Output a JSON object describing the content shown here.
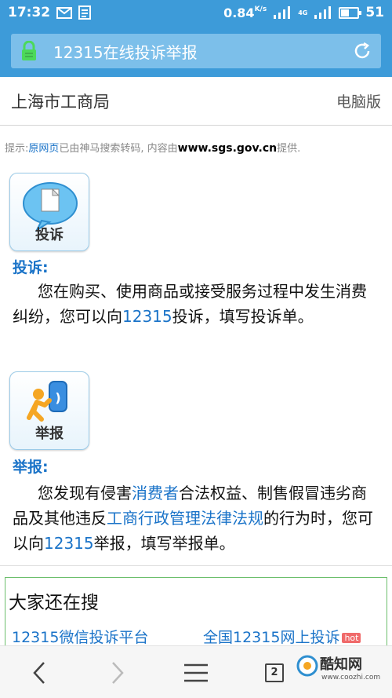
{
  "status_bar": {
    "time": "17:32",
    "speed": "0.84",
    "speed_unit": "K/s",
    "network": "4G",
    "battery": "51",
    "battery_level": 0.51
  },
  "address_bar": {
    "title": "12315在线投诉举报",
    "lock_icon": "lock-icon",
    "refresh_icon": "refresh-icon"
  },
  "site_header": {
    "site_name": "上海市工商局",
    "desktop_label": "电脑版"
  },
  "notice": {
    "prefix": "提示:",
    "link": "原网页",
    "middle": "已由神马搜索转码, 内容由",
    "domain": "www.sgs.gov.cn",
    "suffix": "提供."
  },
  "complaint": {
    "icon_label": "投诉",
    "title": "投诉:",
    "body_before": "您在购买、使用商品或接受服务过程中发生消费纠纷，您可以向",
    "body_link": "12315",
    "body_after": "投诉，填写投诉单。"
  },
  "report": {
    "icon_label": "举报",
    "title": "举报:",
    "body_1": "您发现有侵害",
    "link_1": "消费者",
    "body_2": "合法权益、制售假冒违劣商品及其他违反",
    "link_2": "工商行政管理法律法规",
    "body_3": "的行为时，您可以向",
    "link_3": "12315",
    "body_4": "举报，填写举报单。"
  },
  "searches": {
    "heading": "大家还在搜",
    "items": [
      {
        "label": "12315微信投诉平台",
        "hot": ""
      },
      {
        "label": "全国12315网上投诉",
        "hot": "hot"
      }
    ]
  },
  "bottom_nav": {
    "tab_count": "2",
    "watermark_name": "酷知网",
    "watermark_url": "www.coozhi.com"
  },
  "colors": {
    "accent": "#3d9bd9",
    "link": "#1a73c8"
  }
}
